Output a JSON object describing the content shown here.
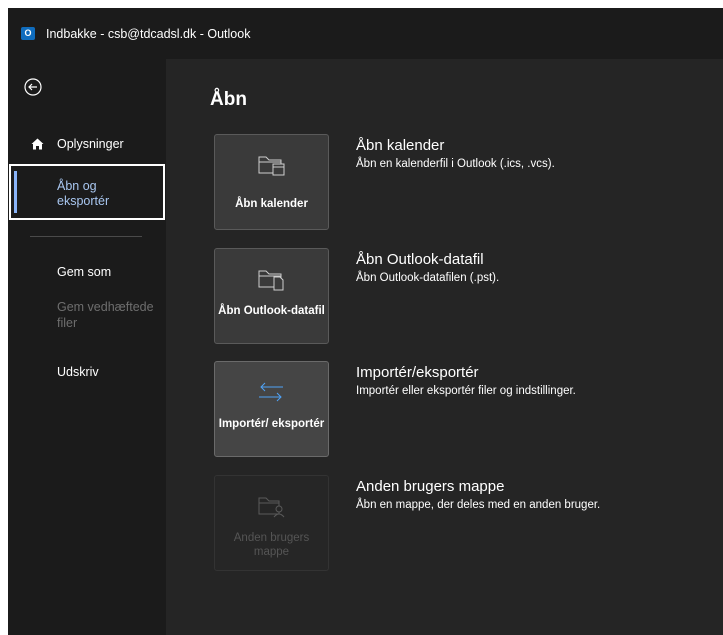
{
  "window": {
    "title": "Indbakke - csb@tdcadsl.dk  -  Outlook",
    "app_icon_letter": "O"
  },
  "sidebar": {
    "back_icon": "back-arrow-icon",
    "items": [
      {
        "label": "Oplysninger",
        "icon": "home-icon"
      },
      {
        "label": "Åbn og eksportér",
        "selected": true
      },
      {
        "label": "Gem som"
      },
      {
        "label": "Gem vedhæftede filer",
        "disabled": true
      },
      {
        "label": "Udskriv"
      }
    ]
  },
  "main": {
    "title": "Åbn",
    "options": [
      {
        "tile_label": "Åbn kalender",
        "icon": "open-calendar-icon",
        "heading": "Åbn kalender",
        "description": "Åbn en kalenderfil i Outlook (.ics, .vcs)."
      },
      {
        "tile_label": "Åbn Outlook-datafil",
        "icon": "open-data-file-icon",
        "heading": "Åbn Outlook-datafil",
        "description": "Åbn Outlook-datafilen (.pst)."
      },
      {
        "tile_label": "Importér/ eksportér",
        "icon": "import-export-icon",
        "heading": "Importér/eksportér",
        "description": "Importér eller eksportér filer og indstillinger."
      },
      {
        "tile_label": "Anden brugers mappe",
        "icon": "shared-folder-icon",
        "heading": "Anden brugers mappe",
        "description": "Åbn en mappe, der deles med en anden bruger.",
        "disabled": true
      }
    ]
  },
  "colors": {
    "background": "#1f1f1f",
    "accent": "#8ab4f8",
    "tile": "#3a3a3a",
    "disabled_text": "#6e6e6e"
  }
}
